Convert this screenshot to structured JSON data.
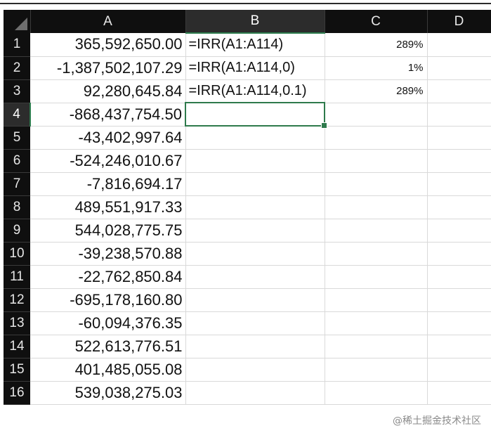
{
  "columns": [
    "A",
    "B",
    "C",
    "D"
  ],
  "rows": [
    {
      "n": "1",
      "a": "365,592,650.00",
      "b": "=IRR(A1:A114)",
      "c": "289%"
    },
    {
      "n": "2",
      "a": "-1,387,502,107.29",
      "b": "=IRR(A1:A114,0)",
      "c": "1%"
    },
    {
      "n": "3",
      "a": "92,280,645.84",
      "b": "=IRR(A1:A114,0.1)",
      "c": "289%"
    },
    {
      "n": "4",
      "a": "-868,437,754.50",
      "b": "",
      "c": ""
    },
    {
      "n": "5",
      "a": "-43,402,997.64",
      "b": "",
      "c": ""
    },
    {
      "n": "6",
      "a": "-524,246,010.67",
      "b": "",
      "c": ""
    },
    {
      "n": "7",
      "a": "-7,816,694.17",
      "b": "",
      "c": ""
    },
    {
      "n": "8",
      "a": "489,551,917.33",
      "b": "",
      "c": ""
    },
    {
      "n": "9",
      "a": "544,028,775.75",
      "b": "",
      "c": ""
    },
    {
      "n": "10",
      "a": "-39,238,570.88",
      "b": "",
      "c": ""
    },
    {
      "n": "11",
      "a": "-22,762,850.84",
      "b": "",
      "c": ""
    },
    {
      "n": "12",
      "a": "-695,178,160.80",
      "b": "",
      "c": ""
    },
    {
      "n": "13",
      "a": "-60,094,376.35",
      "b": "",
      "c": ""
    },
    {
      "n": "14",
      "a": "522,613,776.51",
      "b": "",
      "c": ""
    },
    {
      "n": "15",
      "a": "401,485,055.08",
      "b": "",
      "c": ""
    },
    {
      "n": "16",
      "a": "539,038,275.03",
      "b": "",
      "c": ""
    }
  ],
  "selection": {
    "column": "B",
    "row": "4"
  },
  "watermark": "@稀土掘金技术社区",
  "colors": {
    "header_bg": "#0f0f0f",
    "selection_green": "#2e7a4c",
    "grid": "#d9d9d9"
  }
}
